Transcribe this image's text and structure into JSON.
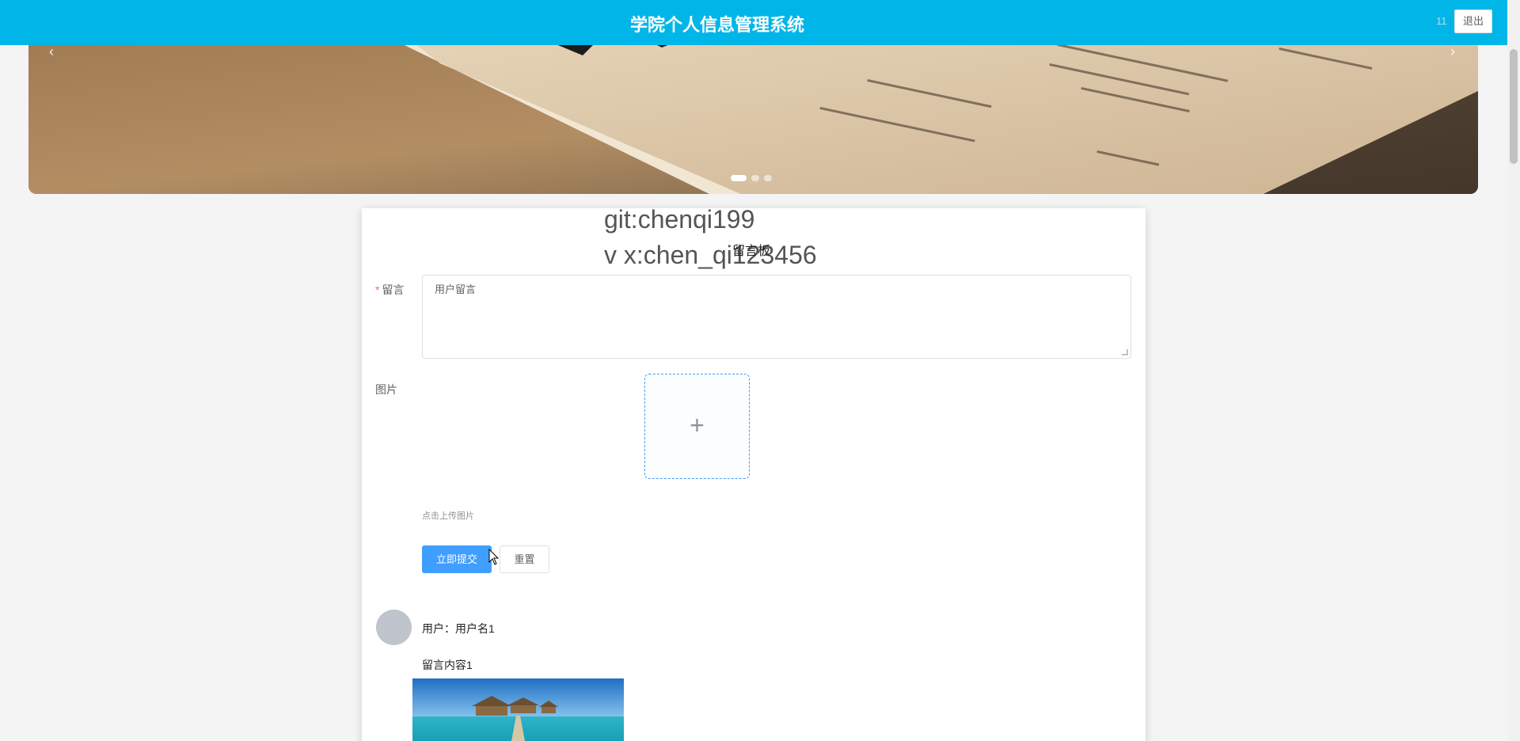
{
  "header": {
    "title": "学院个人信息管理系统",
    "user_label": "11",
    "logout_label": "退出",
    "background_color": "#00b6e8"
  },
  "carousel": {
    "prev_icon": "‹",
    "next_icon": "›",
    "slide_count": 3,
    "active_slide": 1
  },
  "watermark": {
    "line1": "git:chenqi199",
    "line2": "v x:chen_qi123456"
  },
  "board": {
    "title": "留言板"
  },
  "form": {
    "message_label": "留言",
    "message_required_mark": "*",
    "message_placeholder": "用户留言",
    "image_label": "图片",
    "upload_icon": "+",
    "upload_hint": "点击上传图片",
    "submit_label": "立即提交",
    "reset_label": "重置"
  },
  "comments": [
    {
      "user": "用户：用户名1",
      "content": "留言内容1"
    }
  ],
  "colors": {
    "primary": "#409eff",
    "required": "#f56c6c"
  }
}
